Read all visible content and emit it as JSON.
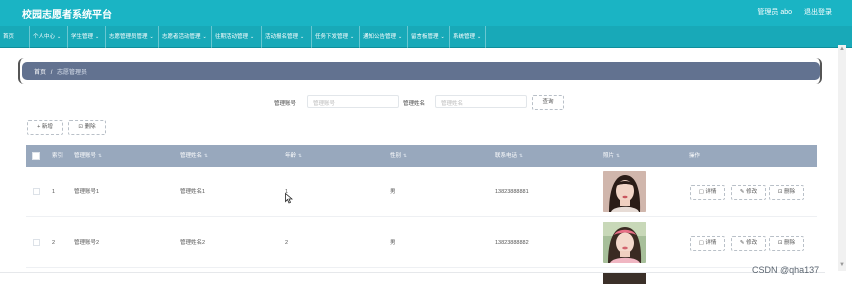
{
  "app": {
    "title": "校园志愿者系统平台",
    "user_label": "管理员 abo",
    "logout_label": "退出登录"
  },
  "nav": {
    "items": [
      {
        "label": "首页",
        "has_dropdown": false
      },
      {
        "label": "个人中心",
        "has_dropdown": true
      },
      {
        "label": "学生管理",
        "has_dropdown": true
      },
      {
        "label": "志愿管理员管理",
        "has_dropdown": true
      },
      {
        "label": "志愿者活动管理",
        "has_dropdown": true
      },
      {
        "label": "往期活动管理",
        "has_dropdown": true
      },
      {
        "label": "活动报名管理",
        "has_dropdown": true
      },
      {
        "label": "任务下发管理",
        "has_dropdown": true
      },
      {
        "label": "通知公告管理",
        "has_dropdown": true
      },
      {
        "label": "留言板管理",
        "has_dropdown": true
      },
      {
        "label": "系统管理",
        "has_dropdown": true
      }
    ]
  },
  "breadcrumb": {
    "home": "首页",
    "separator": "/",
    "current": "志愿管理员"
  },
  "search": {
    "account_label": "管理账号",
    "account_placeholder": "管理账号",
    "name_label": "管理姓名",
    "name_placeholder": "管理姓名",
    "search_button": "查询"
  },
  "toolbar": {
    "add_label": "+ 新增",
    "delete_label": "删除"
  },
  "table": {
    "columns": [
      "索引",
      "管理账号",
      "管理姓名",
      "年龄",
      "性别",
      "联系电话",
      "照片",
      "操作"
    ],
    "rows": [
      {
        "index": "1",
        "account": "管理账号1",
        "name": "管理姓名1",
        "age": "1",
        "gender": "男",
        "phone": "13823888881"
      },
      {
        "index": "2",
        "account": "管理账号2",
        "name": "管理姓名2",
        "age": "2",
        "gender": "男",
        "phone": "13823888882"
      }
    ],
    "actions": {
      "detail": "详情",
      "edit": "修改",
      "delete": "删除"
    }
  },
  "watermark": "CSDN @qha137",
  "colors": {
    "topbar": "#1ab4c4",
    "navbar": "#18a9b8",
    "breadcrumb_bg": "#627290",
    "table_header": "#98a8bd"
  }
}
